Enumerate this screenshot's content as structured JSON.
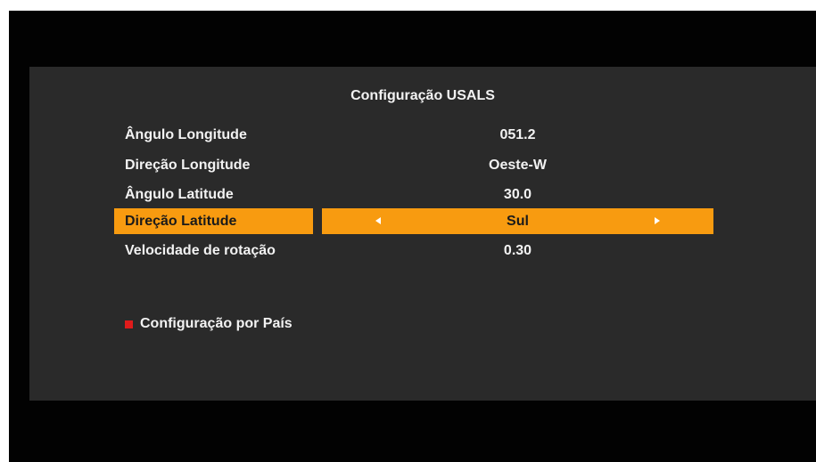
{
  "title": "Configuração USALS",
  "rows": [
    {
      "label": "Ângulo Longitude",
      "value": "051.2"
    },
    {
      "label": "Direção Longitude",
      "value": "Oeste-W"
    },
    {
      "label": "Ângulo Latitude",
      "value": "30.0"
    },
    {
      "label": "Direção Latitude",
      "value": "Sul"
    },
    {
      "label": "Velocidade de rotação",
      "value": "0.30"
    }
  ],
  "hint": {
    "label": "Configuração por País",
    "key_color": "#e01b1b"
  },
  "colors": {
    "highlight": "#f89b10",
    "panel": "#2a2a2a"
  }
}
